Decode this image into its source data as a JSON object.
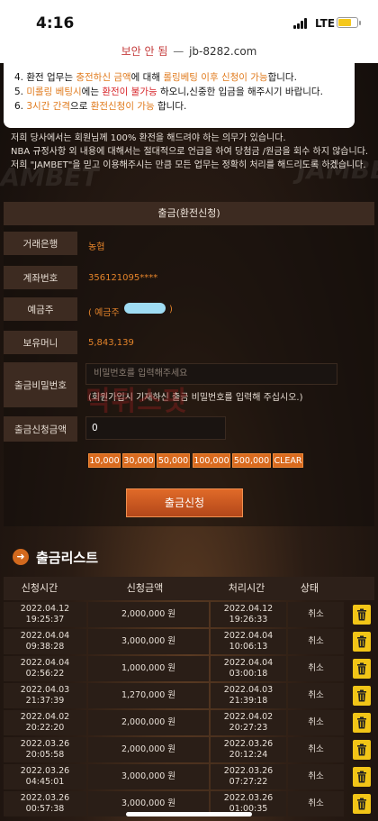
{
  "status": {
    "time": "4:16",
    "network": "LTE"
  },
  "url": {
    "warning": "보안 안 됨",
    "separator": "—",
    "domain": "jb-8282.com"
  },
  "notice": {
    "line4": [
      "4. 환전 업무는 ",
      "충전하신 금액",
      "에 대해 ",
      "롤링베팅 이후 신청이 가능",
      "합니다."
    ],
    "line5": [
      "5. ",
      "미롤링 베팅시",
      "에는 ",
      "환전이 불가능",
      " 하오니,신중한 입금을 해주시기 바랍니다."
    ],
    "line6": [
      "6. ",
      "3시간 간격",
      "으로 ",
      "환전신청이 가능",
      " 합니다."
    ]
  },
  "info": [
    "저희 당사에서는 회원님께 100% 환전을 해드려야 하는 의무가 있습니다.",
    "NBA 규정사항 외 내용에 대해서는 절대적으로 언급을 하여 당첨금 /원금을 회수 하지 않습니다.",
    "저희 \"JAMBET\"을 믿고 이용해주시는 만큼 모든 업무는 정확히 처리를 해드리도록 하겠습니다."
  ],
  "form": {
    "title": "출금(환전신청)",
    "bank_label": "거래은행",
    "bank_value": "농협",
    "account_label": "계좌번호",
    "account_value": "356121095****",
    "holder_label": "예금주",
    "holder_value_open": "( 예금주",
    "holder_value_close": ")",
    "balance_label": "보유머니",
    "balance_value": "5,843,139",
    "password_label": "출금비밀번호",
    "password_placeholder": "비밀번호를 입력해주세요",
    "password_hint": "(회원가입시 기재하신 출금 비밀번호를 입력해 주십시오.)",
    "amount_label": "출금신청금액",
    "amount_value": "0",
    "chips": [
      "10,000",
      "30,000",
      "50,000",
      "100,000",
      "500,000",
      "CLEAR"
    ],
    "submit_label": "출금신청"
  },
  "list": {
    "title": "출금리스트",
    "headers": [
      "신청시간",
      "신청금액",
      "처리시간",
      "상태"
    ],
    "rows": [
      {
        "req_date": "2022.04.12",
        "req_time": "19:25:37",
        "amount": "2,000,000 원",
        "proc_date": "2022.04.12",
        "proc_time": "19:26:33",
        "status": "취소"
      },
      {
        "req_date": "2022.04.04",
        "req_time": "09:38:28",
        "amount": "3,000,000 원",
        "proc_date": "2022.04.04",
        "proc_time": "10:06:13",
        "status": "취소"
      },
      {
        "req_date": "2022.04.04",
        "req_time": "02:56:22",
        "amount": "1,000,000 원",
        "proc_date": "2022.04.04",
        "proc_time": "03:00:18",
        "status": "취소"
      },
      {
        "req_date": "2022.04.03",
        "req_time": "21:37:39",
        "amount": "1,270,000 원",
        "proc_date": "2022.04.03",
        "proc_time": "21:39:18",
        "status": "취소"
      },
      {
        "req_date": "2022.04.02",
        "req_time": "20:22:20",
        "amount": "2,000,000 원",
        "proc_date": "2022.04.02",
        "proc_time": "20:27:23",
        "status": "취소"
      },
      {
        "req_date": "2022.03.26",
        "req_time": "20:05:58",
        "amount": "2,000,000 원",
        "proc_date": "2022.03.26",
        "proc_time": "20:12:24",
        "status": "취소"
      },
      {
        "req_date": "2022.03.26",
        "req_time": "04:45:01",
        "amount": "3,000,000 원",
        "proc_date": "2022.03.26",
        "proc_time": "07:27:22",
        "status": "취소"
      },
      {
        "req_date": "2022.03.26",
        "req_time": "00:57:38",
        "amount": "3,000,000 원",
        "proc_date": "2022.03.26",
        "proc_time": "01:00:35",
        "status": "취소"
      }
    ]
  },
  "watermark": "먹튀스팟",
  "brand_bg": "JAMBET",
  "colors": {
    "accent": "#d96a1e",
    "trash": "#f2c517",
    "warning_red": "#c43a3a"
  },
  "icons": {
    "trash": "trash-icon",
    "arrow": "arrow-right-circle-icon"
  }
}
